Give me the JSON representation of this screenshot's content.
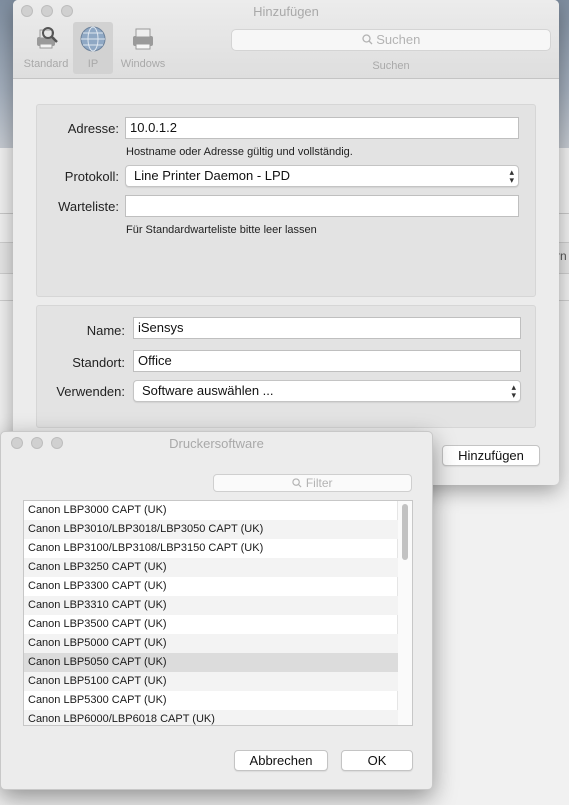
{
  "main_window": {
    "title": "Hinzufügen",
    "toolbar": [
      {
        "label": "Standard",
        "icon": "standard-printer-icon"
      },
      {
        "label": "IP",
        "icon": "globe-icon",
        "selected": true
      },
      {
        "label": "Windows",
        "icon": "windows-printer-icon"
      }
    ],
    "search": {
      "placeholder": "Suchen",
      "caption": "Suchen"
    },
    "address": {
      "label": "Adresse:",
      "value": "10.0.1.2",
      "hint": "Hostname oder Adresse gültig und vollständig."
    },
    "protocol": {
      "label": "Protokoll:",
      "value": "Line Printer Daemon - LPD"
    },
    "queue": {
      "label": "Warteliste:",
      "value": "",
      "hint": "Für Standardwarteliste bitte leer lassen"
    },
    "name": {
      "label": "Name:",
      "value": "iSensys"
    },
    "location": {
      "label": "Standort:",
      "value": "Office"
    },
    "use": {
      "label": "Verwenden:",
      "value": "Software auswählen ..."
    },
    "add_button": "Hinzufügen"
  },
  "background": {
    "partial_text": "rn"
  },
  "sheet": {
    "title": "Druckersoftware",
    "filter_placeholder": "Filter",
    "drivers": [
      "Canon LBP3000 CAPT (UK)",
      "Canon LBP3010/LBP3018/LBP3050 CAPT (UK)",
      "Canon LBP3100/LBP3108/LBP3150 CAPT (UK)",
      "Canon LBP3250 CAPT (UK)",
      "Canon LBP3300 CAPT (UK)",
      "Canon LBP3310 CAPT (UK)",
      "Canon LBP3500 CAPT (UK)",
      "Canon LBP5000 CAPT (UK)",
      "Canon LBP5050 CAPT (UK)",
      "Canon LBP5100 CAPT (UK)",
      "Canon LBP5300 CAPT (UK)",
      "Canon LBP6000/LBP6018 CAPT (UK)"
    ],
    "selected_index": 8,
    "cancel_button": "Abbrechen",
    "ok_button": "OK"
  }
}
